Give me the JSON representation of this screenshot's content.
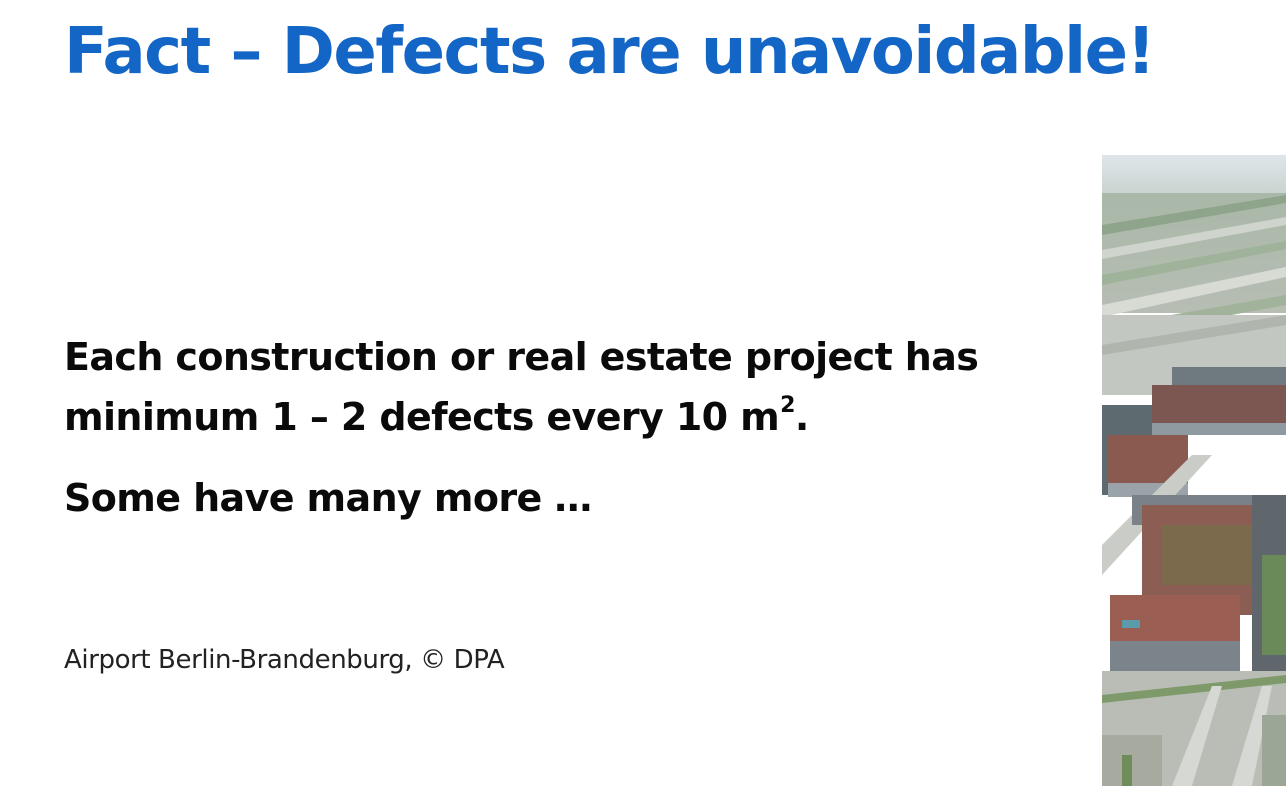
{
  "slide": {
    "title": "Fact – Defects are unavoidable!",
    "body": {
      "line1": "Each construction or real estate project has",
      "line2_main": "minimum 1 – 2 defects every 10 m",
      "line2_sup": "2",
      "line2_end": ".",
      "line3": "Some have many more …"
    },
    "caption": "Airport Berlin-Brandenburg, © DPA"
  },
  "colors": {
    "title": "#1366c6",
    "text": "#0a0a0a",
    "background": "#ffffff"
  }
}
